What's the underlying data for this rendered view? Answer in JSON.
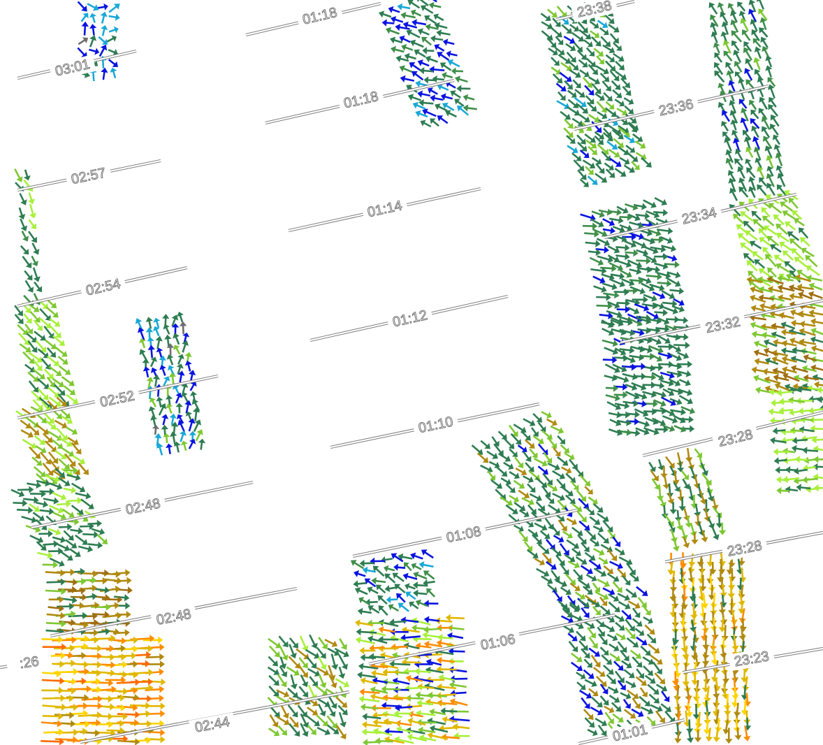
{
  "map": {
    "type": "ocean-current-vector-map",
    "colors": {
      "background": "#ffffff",
      "vector_palette": [
        "#0a14e0",
        "#1aa8d8",
        "#6e6e6e",
        "#2e7d52",
        "#3f8f4a",
        "#7ec832",
        "#a8f03c",
        "#b08a10",
        "#a06f10",
        "#e0b800",
        "#ffd400",
        "#ff8c00",
        "#ff6a00"
      ]
    },
    "tracks": [
      {
        "id": "t-0301",
        "label": "03:01"
      },
      {
        "id": "t-0257",
        "label": "02:57"
      },
      {
        "id": "t-0254",
        "label": "02:54"
      },
      {
        "id": "t-0252",
        "label": "02:52"
      },
      {
        "id": "t-0248a",
        "label": "02:48"
      },
      {
        "id": "t-0248b",
        "label": "02:48"
      },
      {
        "id": "t-0244",
        "label": "02:44"
      },
      {
        "id": "t-0118a",
        "label": "01:18"
      },
      {
        "id": "t-0118b",
        "label": "01:18"
      },
      {
        "id": "t-0114",
        "label": "01:14"
      },
      {
        "id": "t-0112",
        "label": "01:12"
      },
      {
        "id": "t-0110",
        "label": "01:10"
      },
      {
        "id": "t-0108",
        "label": "01:08"
      },
      {
        "id": "t-0106",
        "label": "01:06"
      },
      {
        "id": "t-0101",
        "label": "01:01"
      },
      {
        "id": "t-2338",
        "label": "23:38"
      },
      {
        "id": "t-2336",
        "label": "23:36"
      },
      {
        "id": "t-2334",
        "label": "23:34"
      },
      {
        "id": "t-2332",
        "label": "23:32"
      },
      {
        "id": "t-2328a",
        "label": "23:28"
      },
      {
        "id": "t-2328b",
        "label": "23:28"
      },
      {
        "id": "t-2323",
        "label": "23:23"
      },
      {
        "id": "t-x26",
        "label": ":26"
      }
    ]
  }
}
